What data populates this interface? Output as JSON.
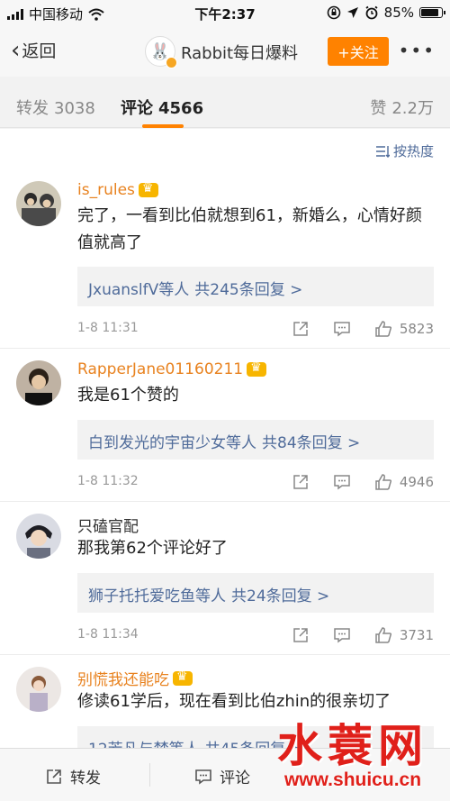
{
  "status_bar": {
    "carrier": "中国移动",
    "time": "下午2:37",
    "battery": "85%",
    "battery_level": 0.85,
    "icons": [
      "signal-icon",
      "wifi-icon",
      "rotation-lock-icon",
      "location-icon",
      "alarm-icon",
      "battery-icon"
    ]
  },
  "nav": {
    "back_label": "返回",
    "title": "Rabbit每日爆料",
    "follow_label": "+关注",
    "more_label": "•••"
  },
  "tabs": {
    "repost_label": "转发",
    "repost_count": "3038",
    "comment_label": "评论",
    "comment_count": "4566",
    "like_label": "赞",
    "like_count": "2.2万"
  },
  "sort_label": "按热度",
  "comments": [
    {
      "user": "is_rules",
      "text": "完了，一看到比伯就想到61，新婚么，心情好颜值就高了",
      "reply_users": "JxuanslfV等人",
      "reply_count": "共245条回复 >",
      "time": "1-8 11:31",
      "likes": "5823"
    },
    {
      "user": "RapperJane01160211",
      "text": "我是61个赞的",
      "reply_users": "白到发光的宇宙少女等人",
      "reply_count": "共84条回复 >",
      "time": "1-8 11:32",
      "likes": "4946"
    },
    {
      "user": "只磕官配",
      "text": "那我第62个评论好了",
      "reply_users": "狮子托托爱吃鱼等人",
      "reply_count": "共24条回复 >",
      "time": "1-8 11:34",
      "likes": "3731"
    },
    {
      "user": "别慌我还能吃",
      "text": "修读61学后，现在看到比伯zhin的很亲切了",
      "reply_users": "12芳凡与梦等人",
      "reply_count": "共45条回复 >"
    }
  ],
  "bottom_bar": {
    "repost_label": "转发",
    "comment_label": "评论"
  },
  "watermark": {
    "text": "水蓑网",
    "url": "www.shuicu.cn"
  },
  "colors": {
    "accent": "#ff8200",
    "link": "#4f6b9a",
    "vip_name": "#e8821f"
  }
}
